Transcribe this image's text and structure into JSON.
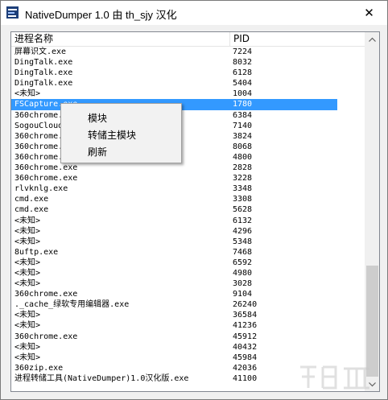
{
  "window": {
    "title": "NativeDumper 1.0 由 th_sjy 汉化",
    "close_glyph": "✕"
  },
  "columns": {
    "name": "进程名称",
    "pid": "PID"
  },
  "rows": [
    {
      "name": "屏幕识文.exe",
      "pid": "7224"
    },
    {
      "name": "DingTalk.exe",
      "pid": "8032"
    },
    {
      "name": "DingTalk.exe",
      "pid": "6128"
    },
    {
      "name": "DingTalk.exe",
      "pid": "5404"
    },
    {
      "name": "<未知>",
      "pid": "1004"
    },
    {
      "name": "FSCapture.exe",
      "pid": "1780",
      "selected": true
    },
    {
      "name": "360chrome.",
      "pid": "6384"
    },
    {
      "name": "SogouCloud",
      "pid": "7140"
    },
    {
      "name": "360chrome.",
      "pid": "3824"
    },
    {
      "name": "360chrome.",
      "pid": "8068"
    },
    {
      "name": "360chrome.",
      "pid": "4800"
    },
    {
      "name": "360chrome.exe",
      "pid": "2828"
    },
    {
      "name": "360chrome.exe",
      "pid": "3228"
    },
    {
      "name": "rlvknlg.exe",
      "pid": "3348"
    },
    {
      "name": "cmd.exe",
      "pid": "3308"
    },
    {
      "name": "cmd.exe",
      "pid": "5628"
    },
    {
      "name": "<未知>",
      "pid": "6132"
    },
    {
      "name": "<未知>",
      "pid": "4296"
    },
    {
      "name": "<未知>",
      "pid": "5348"
    },
    {
      "name": "8uftp.exe",
      "pid": "7468"
    },
    {
      "name": "<未知>",
      "pid": "6592"
    },
    {
      "name": "<未知>",
      "pid": "4980"
    },
    {
      "name": "<未知>",
      "pid": "3028"
    },
    {
      "name": "360chrome.exe",
      "pid": "9104"
    },
    {
      "name": "._cache_绿软专用编辑器.exe",
      "pid": "26240"
    },
    {
      "name": "<未知>",
      "pid": "36584"
    },
    {
      "name": "<未知>",
      "pid": "41236"
    },
    {
      "name": "360chrome.exe",
      "pid": "45912"
    },
    {
      "name": "<未知>",
      "pid": "40432"
    },
    {
      "name": "<未知>",
      "pid": "45984"
    },
    {
      "name": "360zip.exe",
      "pid": "42036"
    },
    {
      "name": "进程转储工具(NativeDumper)1.0汉化版.exe",
      "pid": "41100"
    }
  ],
  "context_menu": {
    "items": [
      "模块",
      "转储主模块",
      "刷新"
    ]
  },
  "colors": {
    "selection": "#3399ff",
    "menu_bg": "#f2f2f2",
    "scroll_thumb": "#cdcdcd"
  }
}
